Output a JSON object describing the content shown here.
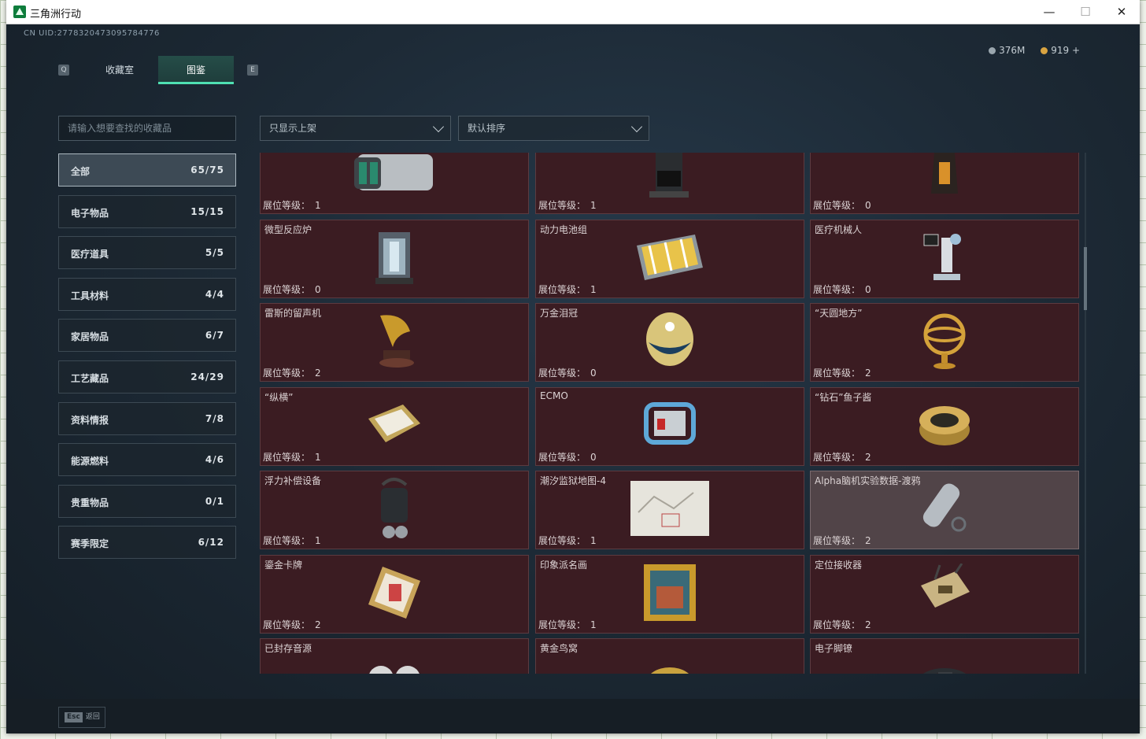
{
  "window": {
    "title": "三角洲行动",
    "min": "—",
    "max": "☐",
    "close": "✕"
  },
  "uid": "CN UID:2778320473095784776",
  "tabs": {
    "prev_key": "Q",
    "next_key": "E",
    "items": [
      {
        "label": "收藏室"
      },
      {
        "label": "图鉴"
      }
    ]
  },
  "currency": {
    "a": "376M",
    "b": "919 +"
  },
  "search": {
    "placeholder": "请输入想要查找的收藏品"
  },
  "filter": {
    "shelf": "只显示上架",
    "sort": "默认排序"
  },
  "categories": [
    {
      "label": "全部",
      "count": "65/75"
    },
    {
      "label": "电子物品",
      "count": "15/15"
    },
    {
      "label": "医疗道具",
      "count": "5/5"
    },
    {
      "label": "工具材料",
      "count": "4/4"
    },
    {
      "label": "家居物品",
      "count": "6/7"
    },
    {
      "label": "工艺藏品",
      "count": "24/29"
    },
    {
      "label": "资料情报",
      "count": "7/8"
    },
    {
      "label": "能源燃料",
      "count": "4/6"
    },
    {
      "label": "贵重物品",
      "count": "0/1"
    },
    {
      "label": "赛季限定",
      "count": "6/12"
    }
  ],
  "level_label": "展位等级：",
  "cards": [
    {
      "name": "",
      "level": "1",
      "icon": "server-icon"
    },
    {
      "name": "",
      "level": "1",
      "icon": "coffee-machine-icon"
    },
    {
      "name": "",
      "level": "0",
      "icon": "coffee-bag-icon"
    },
    {
      "name": "微型反应炉",
      "level": "0",
      "icon": "reactor-icon"
    },
    {
      "name": "动力电池组",
      "level": "1",
      "icon": "battery-pack-icon"
    },
    {
      "name": "医疗机械人",
      "level": "0",
      "icon": "medical-robot-icon"
    },
    {
      "name": "雷斯的留声机",
      "level": "2",
      "icon": "gramophone-icon"
    },
    {
      "name": "万金泪冠",
      "level": "0",
      "icon": "jeweled-egg-icon"
    },
    {
      "name": "“天圆地方”",
      "level": "2",
      "icon": "armillary-sphere-icon"
    },
    {
      "name": "“纵横”",
      "level": "1",
      "icon": "chessboard-icon"
    },
    {
      "name": "ECMO",
      "level": "0",
      "icon": "ecmo-icon"
    },
    {
      "name": "“钻石”鱼子酱",
      "level": "2",
      "icon": "caviar-tin-icon"
    },
    {
      "name": "浮力补偿设备",
      "level": "1",
      "icon": "diving-gear-icon"
    },
    {
      "name": "潮汐监狱地图-4",
      "level": "1",
      "icon": "map-icon"
    },
    {
      "name": "Alpha脑机实验数据-渡鸦",
      "level": "2",
      "icon": "data-cylinder-icon",
      "highlight": true
    },
    {
      "name": "鎏金卡牌",
      "level": "2",
      "icon": "gilded-card-icon"
    },
    {
      "name": "印象派名画",
      "level": "1",
      "icon": "painting-icon"
    },
    {
      "name": "定位接收器",
      "level": "2",
      "icon": "receiver-icon"
    },
    {
      "name": "已封存音源",
      "level": "",
      "icon": "reel-tape-icon"
    },
    {
      "name": "黄金鸟窝",
      "level": "",
      "icon": "gold-nest-icon"
    },
    {
      "name": "电子脚镣",
      "level": "",
      "icon": "ankle-monitor-icon"
    }
  ],
  "footer": {
    "esc_key": "Esc",
    "esc_label": "返回"
  },
  "colors": {
    "accent": "#4fe0b2",
    "card_bg": "#3b1c22",
    "card_highlight": "#514448"
  }
}
